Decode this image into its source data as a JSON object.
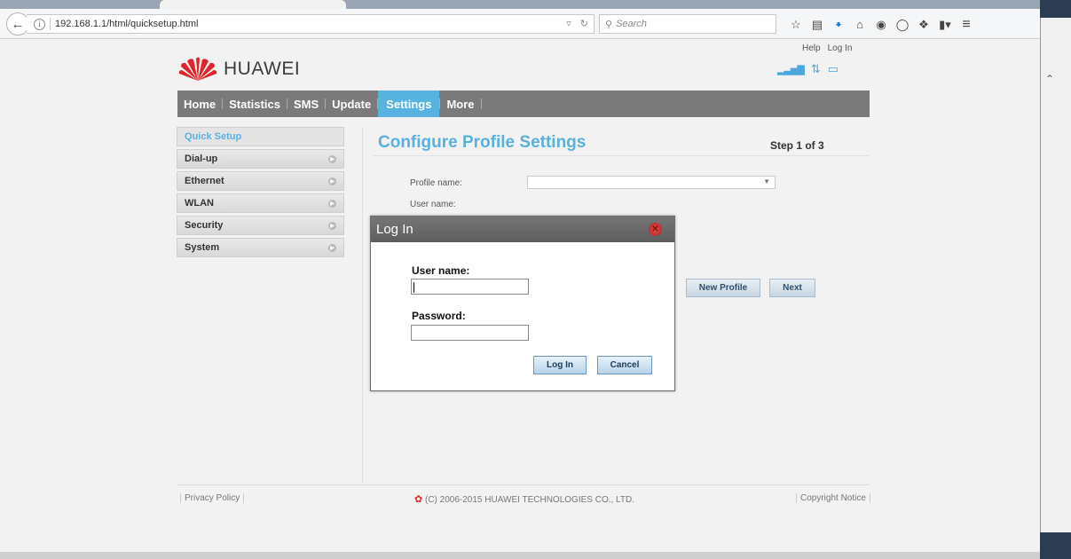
{
  "browser": {
    "url": "192.168.1.1/html/quicksetup.html",
    "search_placeholder": "Search",
    "toolbar_icons": [
      "bookmark-star-icon",
      "reading-list-icon",
      "download-icon",
      "home-icon",
      "chat-icon",
      "pocket-icon",
      "extension-icon",
      "sidebar-icon",
      "menu-icon"
    ]
  },
  "header": {
    "brand": "HUAWEI",
    "top_links": [
      "Help",
      "Log In"
    ],
    "nav": [
      {
        "label": "Home",
        "active": false
      },
      {
        "label": "Statistics",
        "active": false
      },
      {
        "label": "SMS",
        "active": false
      },
      {
        "label": "Update",
        "active": false
      },
      {
        "label": "Settings",
        "active": true
      },
      {
        "label": "More",
        "active": false
      }
    ]
  },
  "sidebar": {
    "items": [
      {
        "label": "Quick Setup",
        "active": true
      },
      {
        "label": "Dial-up",
        "active": false
      },
      {
        "label": "Ethernet",
        "active": false
      },
      {
        "label": "WLAN",
        "active": false
      },
      {
        "label": "Security",
        "active": false
      },
      {
        "label": "System",
        "active": false
      }
    ]
  },
  "content": {
    "title": "Configure Profile Settings",
    "step": "Step 1 of 3",
    "profile_label": "Profile name:",
    "username_label": "User name:",
    "new_profile_button": "New Profile",
    "next_button": "Next"
  },
  "footer": {
    "privacy": "Privacy Policy",
    "copyright": "(C) 2006-2015 HUAWEI TECHNOLOGIES CO., LTD.",
    "notice": "Copyright Notice"
  },
  "modal": {
    "title": "Log In",
    "username_label": "User name:",
    "username_value": "",
    "password_label": "Password:",
    "password_value": "",
    "login_button": "Log In",
    "cancel_button": "Cancel"
  },
  "colors": {
    "accent": "#58b2e0",
    "nav_bg": "#7a7a7a",
    "brand_red": "#e0242b"
  }
}
